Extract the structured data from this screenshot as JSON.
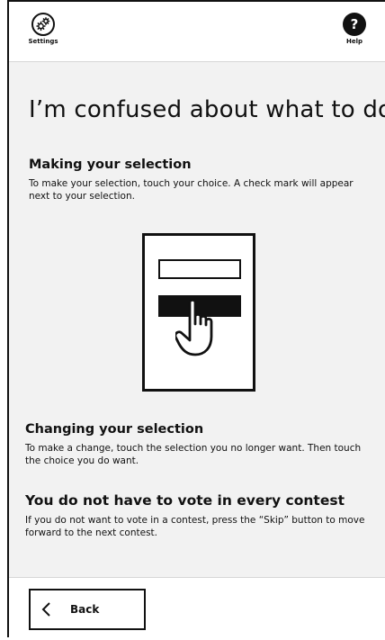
{
  "header": {
    "settings": {
      "icon": "gears-icon",
      "label": "Settings"
    },
    "help": {
      "icon": "question-mark-icon",
      "glyph": "?",
      "label": "Help"
    }
  },
  "main": {
    "title": "I’m confused about what to do",
    "sections": [
      {
        "heading": "Making your selection",
        "body": "To make your selection, touch your choice. A check mark will appear next to your selection."
      },
      {
        "heading": "Changing your selection",
        "body": "To make a change, touch the selection you no longer want. Then touch the choice you do want."
      },
      {
        "heading": "You do not have to vote in every contest",
        "body": "If you do not want to vote in a contest, press the “Skip” button to move forward to the next contest."
      }
    ],
    "illustration": {
      "icon": "ballot-touch-hand-icon"
    }
  },
  "footer": {
    "back": {
      "icon": "chevron-left-icon",
      "label": "Back"
    }
  },
  "colors": {
    "background": "#f2f2f2",
    "panel": "#ffffff",
    "ink": "#111111",
    "divider": "#d6d6d6"
  }
}
